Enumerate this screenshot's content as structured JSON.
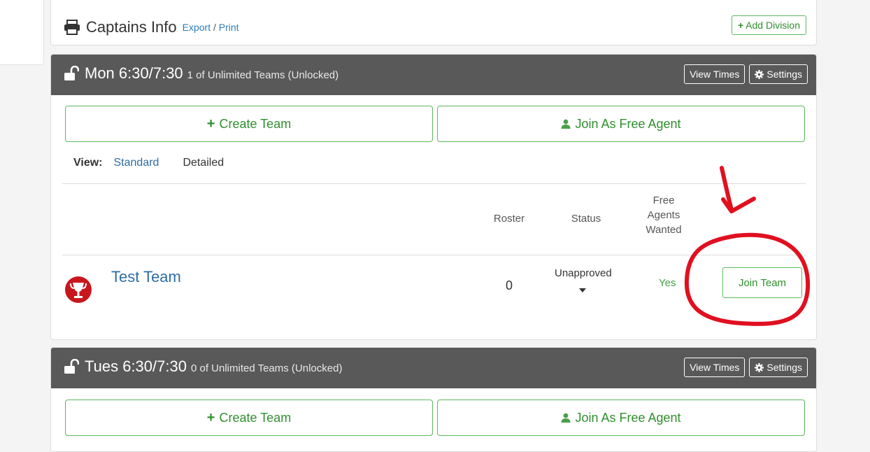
{
  "captains": {
    "title": "Captains Info",
    "export_label": "Export",
    "print_label": "Print",
    "add_division_label": "Add Division"
  },
  "divisions": [
    {
      "name": "Mon 6:30/7:30",
      "subtitle": "1 of Unlimited Teams (Unlocked)",
      "view_times_label": "View Times",
      "settings_label": "Settings",
      "create_team_label": "Create Team",
      "free_agent_label": "Join As Free Agent",
      "view_label": "View:",
      "view_standard": "Standard",
      "view_detailed": "Detailed",
      "columns": {
        "roster": "Roster",
        "status": "Status",
        "free_line1": "Free",
        "free_line2": "Agents",
        "free_line3": "Wanted"
      },
      "teams": [
        {
          "name": "Test Team",
          "roster": "0",
          "status": "Unapproved",
          "free_agents_wanted": "Yes",
          "join_label": "Join Team"
        }
      ]
    },
    {
      "name": "Tues 6:30/7:30",
      "subtitle": "0 of Unlimited Teams (Unlocked)",
      "view_times_label": "View Times",
      "settings_label": "Settings",
      "create_team_label": "Create Team",
      "free_agent_label": "Join As Free Agent"
    }
  ],
  "colors": {
    "header_bg": "#595959",
    "accent_green": "#5cb85c",
    "link_blue": "#2e6da4",
    "annotation_red": "#e01020"
  }
}
